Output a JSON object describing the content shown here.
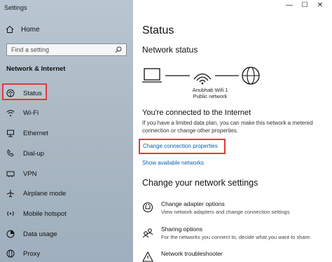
{
  "app": {
    "title": "Settings"
  },
  "window_controls": {
    "minimize": "—",
    "maximize": "☐",
    "close": "✕"
  },
  "sidebar": {
    "home_label": "Home",
    "search_placeholder": "Find a setting",
    "section_label": "Network & Internet",
    "items": [
      {
        "label": "Status",
        "icon": "status-globe-icon",
        "active": true
      },
      {
        "label": "Wi-Fi",
        "icon": "wifi-icon"
      },
      {
        "label": "Ethernet",
        "icon": "ethernet-icon"
      },
      {
        "label": "Dial-up",
        "icon": "dialup-icon"
      },
      {
        "label": "VPN",
        "icon": "vpn-icon"
      },
      {
        "label": "Airplane mode",
        "icon": "airplane-icon"
      },
      {
        "label": "Mobile hotspot",
        "icon": "hotspot-icon"
      },
      {
        "label": "Data usage",
        "icon": "data-usage-icon"
      },
      {
        "label": "Proxy",
        "icon": "proxy-icon"
      }
    ]
  },
  "main": {
    "title": "Status",
    "network_status_heading": "Network status",
    "network_name": "Anubhab Wifi 1",
    "network_type": "Public network",
    "connected_heading": "You're connected to the Internet",
    "connected_desc": "If you have a limited data plan, you can make this network a metered connection or change other properties.",
    "change_connection_link": "Change connection properties",
    "show_networks_link": "Show available networks",
    "change_settings_heading": "Change your network settings",
    "options": [
      {
        "title": "Change adapter options",
        "desc": "View network adapters and change connection settings.",
        "icon": "adapter-icon"
      },
      {
        "title": "Sharing options",
        "desc": "For the networks you connect to, decide what you want to share.",
        "icon": "sharing-icon"
      },
      {
        "title": "Network troubleshooter",
        "desc": "",
        "icon": "troubleshooter-icon"
      }
    ]
  },
  "colors": {
    "accent": "#0a5fb0",
    "highlight": "#e0393e",
    "sidebar_bg": "#aebcc8"
  }
}
